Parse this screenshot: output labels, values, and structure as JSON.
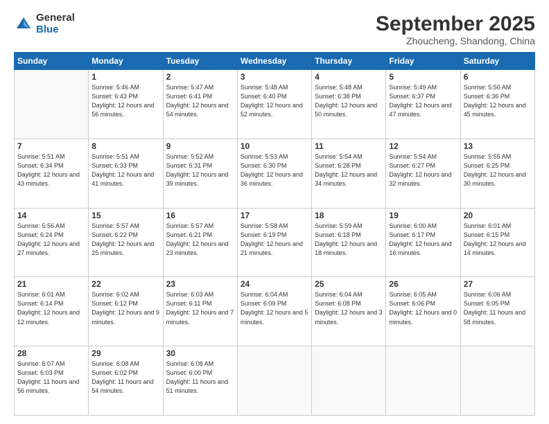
{
  "logo": {
    "general": "General",
    "blue": "Blue"
  },
  "header": {
    "month": "September 2025",
    "location": "Zhoucheng, Shandong, China"
  },
  "weekdays": [
    "Sunday",
    "Monday",
    "Tuesday",
    "Wednesday",
    "Thursday",
    "Friday",
    "Saturday"
  ],
  "weeks": [
    [
      {
        "day": "",
        "info": ""
      },
      {
        "day": "1",
        "info": "Sunrise: 5:46 AM\nSunset: 6:43 PM\nDaylight: 12 hours\nand 56 minutes."
      },
      {
        "day": "2",
        "info": "Sunrise: 5:47 AM\nSunset: 6:41 PM\nDaylight: 12 hours\nand 54 minutes."
      },
      {
        "day": "3",
        "info": "Sunrise: 5:48 AM\nSunset: 6:40 PM\nDaylight: 12 hours\nand 52 minutes."
      },
      {
        "day": "4",
        "info": "Sunrise: 5:48 AM\nSunset: 6:38 PM\nDaylight: 12 hours\nand 50 minutes."
      },
      {
        "day": "5",
        "info": "Sunrise: 5:49 AM\nSunset: 6:37 PM\nDaylight: 12 hours\nand 47 minutes."
      },
      {
        "day": "6",
        "info": "Sunrise: 5:50 AM\nSunset: 6:36 PM\nDaylight: 12 hours\nand 45 minutes."
      }
    ],
    [
      {
        "day": "7",
        "info": "Sunrise: 5:51 AM\nSunset: 6:34 PM\nDaylight: 12 hours\nand 43 minutes."
      },
      {
        "day": "8",
        "info": "Sunrise: 5:51 AM\nSunset: 6:33 PM\nDaylight: 12 hours\nand 41 minutes."
      },
      {
        "day": "9",
        "info": "Sunrise: 5:52 AM\nSunset: 6:31 PM\nDaylight: 12 hours\nand 39 minutes."
      },
      {
        "day": "10",
        "info": "Sunrise: 5:53 AM\nSunset: 6:30 PM\nDaylight: 12 hours\nand 36 minutes."
      },
      {
        "day": "11",
        "info": "Sunrise: 5:54 AM\nSunset: 6:28 PM\nDaylight: 12 hours\nand 34 minutes."
      },
      {
        "day": "12",
        "info": "Sunrise: 5:54 AM\nSunset: 6:27 PM\nDaylight: 12 hours\nand 32 minutes."
      },
      {
        "day": "13",
        "info": "Sunrise: 5:55 AM\nSunset: 6:25 PM\nDaylight: 12 hours\nand 30 minutes."
      }
    ],
    [
      {
        "day": "14",
        "info": "Sunrise: 5:56 AM\nSunset: 6:24 PM\nDaylight: 12 hours\nand 27 minutes."
      },
      {
        "day": "15",
        "info": "Sunrise: 5:57 AM\nSunset: 6:22 PM\nDaylight: 12 hours\nand 25 minutes."
      },
      {
        "day": "16",
        "info": "Sunrise: 5:57 AM\nSunset: 6:21 PM\nDaylight: 12 hours\nand 23 minutes."
      },
      {
        "day": "17",
        "info": "Sunrise: 5:58 AM\nSunset: 6:19 PM\nDaylight: 12 hours\nand 21 minutes."
      },
      {
        "day": "18",
        "info": "Sunrise: 5:59 AM\nSunset: 6:18 PM\nDaylight: 12 hours\nand 18 minutes."
      },
      {
        "day": "19",
        "info": "Sunrise: 6:00 AM\nSunset: 6:17 PM\nDaylight: 12 hours\nand 16 minutes."
      },
      {
        "day": "20",
        "info": "Sunrise: 6:01 AM\nSunset: 6:15 PM\nDaylight: 12 hours\nand 14 minutes."
      }
    ],
    [
      {
        "day": "21",
        "info": "Sunrise: 6:01 AM\nSunset: 6:14 PM\nDaylight: 12 hours\nand 12 minutes."
      },
      {
        "day": "22",
        "info": "Sunrise: 6:02 AM\nSunset: 6:12 PM\nDaylight: 12 hours\nand 9 minutes."
      },
      {
        "day": "23",
        "info": "Sunrise: 6:03 AM\nSunset: 6:11 PM\nDaylight: 12 hours\nand 7 minutes."
      },
      {
        "day": "24",
        "info": "Sunrise: 6:04 AM\nSunset: 6:09 PM\nDaylight: 12 hours\nand 5 minutes."
      },
      {
        "day": "25",
        "info": "Sunrise: 6:04 AM\nSunset: 6:08 PM\nDaylight: 12 hours\nand 3 minutes."
      },
      {
        "day": "26",
        "info": "Sunrise: 6:05 AM\nSunset: 6:06 PM\nDaylight: 12 hours\nand 0 minutes."
      },
      {
        "day": "27",
        "info": "Sunrise: 6:06 AM\nSunset: 6:05 PM\nDaylight: 11 hours\nand 58 minutes."
      }
    ],
    [
      {
        "day": "28",
        "info": "Sunrise: 6:07 AM\nSunset: 6:03 PM\nDaylight: 11 hours\nand 56 minutes."
      },
      {
        "day": "29",
        "info": "Sunrise: 6:08 AM\nSunset: 6:02 PM\nDaylight: 11 hours\nand 54 minutes."
      },
      {
        "day": "30",
        "info": "Sunrise: 6:08 AM\nSunset: 6:00 PM\nDaylight: 11 hours\nand 51 minutes."
      },
      {
        "day": "",
        "info": ""
      },
      {
        "day": "",
        "info": ""
      },
      {
        "day": "",
        "info": ""
      },
      {
        "day": "",
        "info": ""
      }
    ]
  ]
}
